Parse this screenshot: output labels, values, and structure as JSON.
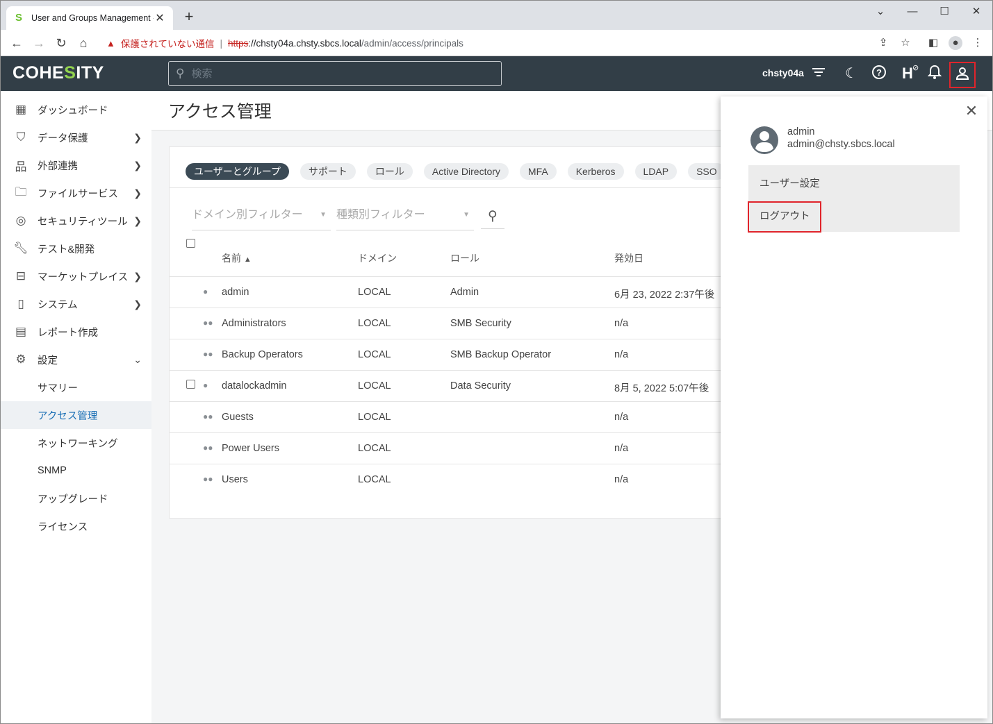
{
  "browser": {
    "tab_title": "User and Groups Management -",
    "tab_close": "✕",
    "new_tab": "+",
    "insecure_label": "保護されていない通信",
    "url_scheme": "https",
    "url_host": "://chsty04a.chsty.sbcs.local",
    "url_path": "/admin/access/principals"
  },
  "app": {
    "logo_pre": "COHE",
    "logo_s": "S",
    "logo_post": "ITY",
    "search_placeholder": "検索",
    "cluster_name": "chsty04a",
    "health_label": "H"
  },
  "sidebar": {
    "items": [
      {
        "label": "ダッシュボード",
        "icon": "dashboard-icon"
      },
      {
        "label": "データ保護",
        "icon": "shield-icon"
      },
      {
        "label": "外部連携",
        "icon": "hierarchy-icon"
      },
      {
        "label": "ファイルサービス",
        "icon": "folder-icon"
      },
      {
        "label": "セキュリティツール",
        "icon": "fingerprint-icon"
      },
      {
        "label": "テスト&開発",
        "icon": "wrench-icon"
      },
      {
        "label": "マーケットプレイス",
        "icon": "store-icon"
      },
      {
        "label": "システム",
        "icon": "system-icon"
      },
      {
        "label": "レポート作成",
        "icon": "report-icon"
      },
      {
        "label": "設定",
        "icon": "gear-icon"
      }
    ],
    "sub_items": [
      "サマリー",
      "アクセス管理",
      "ネットワーキング",
      "SNMP",
      "アップグレード",
      "ライセンス"
    ]
  },
  "page": {
    "title": "アクセス管理",
    "tabs": [
      "ユーザーとグループ",
      "サポート",
      "ロール",
      "Active Directory",
      "MFA",
      "Kerberos",
      "LDAP",
      "SSO"
    ],
    "filter_domain_placeholder": "ドメイン別フィルター",
    "filter_type_placeholder": "種類別フィルター",
    "columns": {
      "name": "名前",
      "domain": "ドメイン",
      "role": "ロール",
      "effective": "発効日"
    },
    "rows": [
      {
        "name": "admin",
        "domain": "LOCAL",
        "role": "Admin",
        "date": "6月 23, 2022 2:37午後"
      },
      {
        "name": "Administrators",
        "domain": "LOCAL",
        "role": "SMB Security",
        "date": "n/a"
      },
      {
        "name": "Backup Operators",
        "domain": "LOCAL",
        "role": "SMB Backup Operator",
        "date": "n/a"
      },
      {
        "name": "datalockadmin",
        "domain": "LOCAL",
        "role": "Data Security",
        "date": "8月 5, 2022 5:07午後"
      },
      {
        "name": "Guests",
        "domain": "LOCAL",
        "role": "",
        "date": "n/a"
      },
      {
        "name": "Power Users",
        "domain": "LOCAL",
        "role": "",
        "date": "n/a"
      },
      {
        "name": "Users",
        "domain": "LOCAL",
        "role": "",
        "date": "n/a"
      }
    ]
  },
  "flyout": {
    "username": "admin",
    "email": "admin@chsty.sbcs.local",
    "user_settings": "ユーザー設定",
    "logout": "ログアウト"
  },
  "colors": {
    "appbar": "#323e47",
    "accent_green": "#93d34f",
    "highlight_red": "#e0242b",
    "active_chip": "#3b4a55",
    "active_nav_text": "#1a6fb5"
  }
}
